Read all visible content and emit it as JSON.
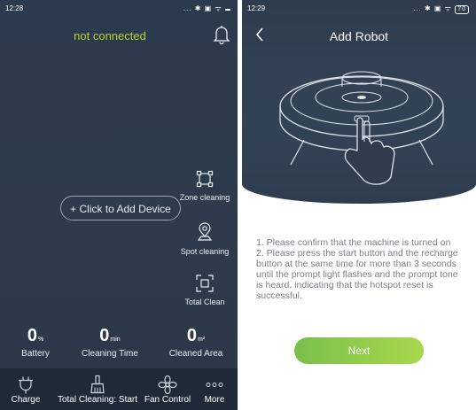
{
  "left_screen": {
    "status_time": "12:28",
    "status_icons": "... ✱ ▣ ᯤ",
    "battery_icon": "",
    "connection_status": "not connected",
    "add_device_label": "+ Click to Add Device",
    "tools": [
      {
        "label": "Zone cleaning",
        "icon": "zone-cleaning-icon"
      },
      {
        "label": "Spot cleaning",
        "icon": "spot-cleaning-icon"
      },
      {
        "label": "Total Clean",
        "icon": "total-clean-icon"
      }
    ],
    "stats": [
      {
        "value": "0",
        "unit": "%",
        "label": "Battery"
      },
      {
        "value": "0",
        "unit": "min",
        "label": "Cleaning Time"
      },
      {
        "value": "0",
        "unit": "m²",
        "label": "Cleaned Area"
      }
    ],
    "nav": [
      {
        "label": "Charge",
        "icon": "charge-icon"
      },
      {
        "label": "Total Cleaning: Start",
        "icon": "broom-icon"
      },
      {
        "label": "Fan Control",
        "icon": "fan-icon"
      },
      {
        "label": "More",
        "icon": "more-dots-icon"
      }
    ],
    "colors": {
      "accent_green": "#b7d433",
      "background": "#2b3a4c",
      "nav_bg": "#1e2a38"
    }
  },
  "right_screen": {
    "status_time": "12:29",
    "status_icons": "... ✱ ▣ ᯤ",
    "battery_level": "70",
    "title": "Add Robot",
    "instructions": [
      "1. Please confirm that the machine is turned on",
      "2. Please press the start button and the recharge button at the same time for more than 3 seconds until the prompt light flashes and the prompt tone is heard, indicating that the hotspot reset is successful."
    ],
    "next_label": "Next",
    "colors": {
      "button_start": "#79c04a",
      "button_end": "#a9d84d",
      "text": "#7a7f86"
    }
  }
}
